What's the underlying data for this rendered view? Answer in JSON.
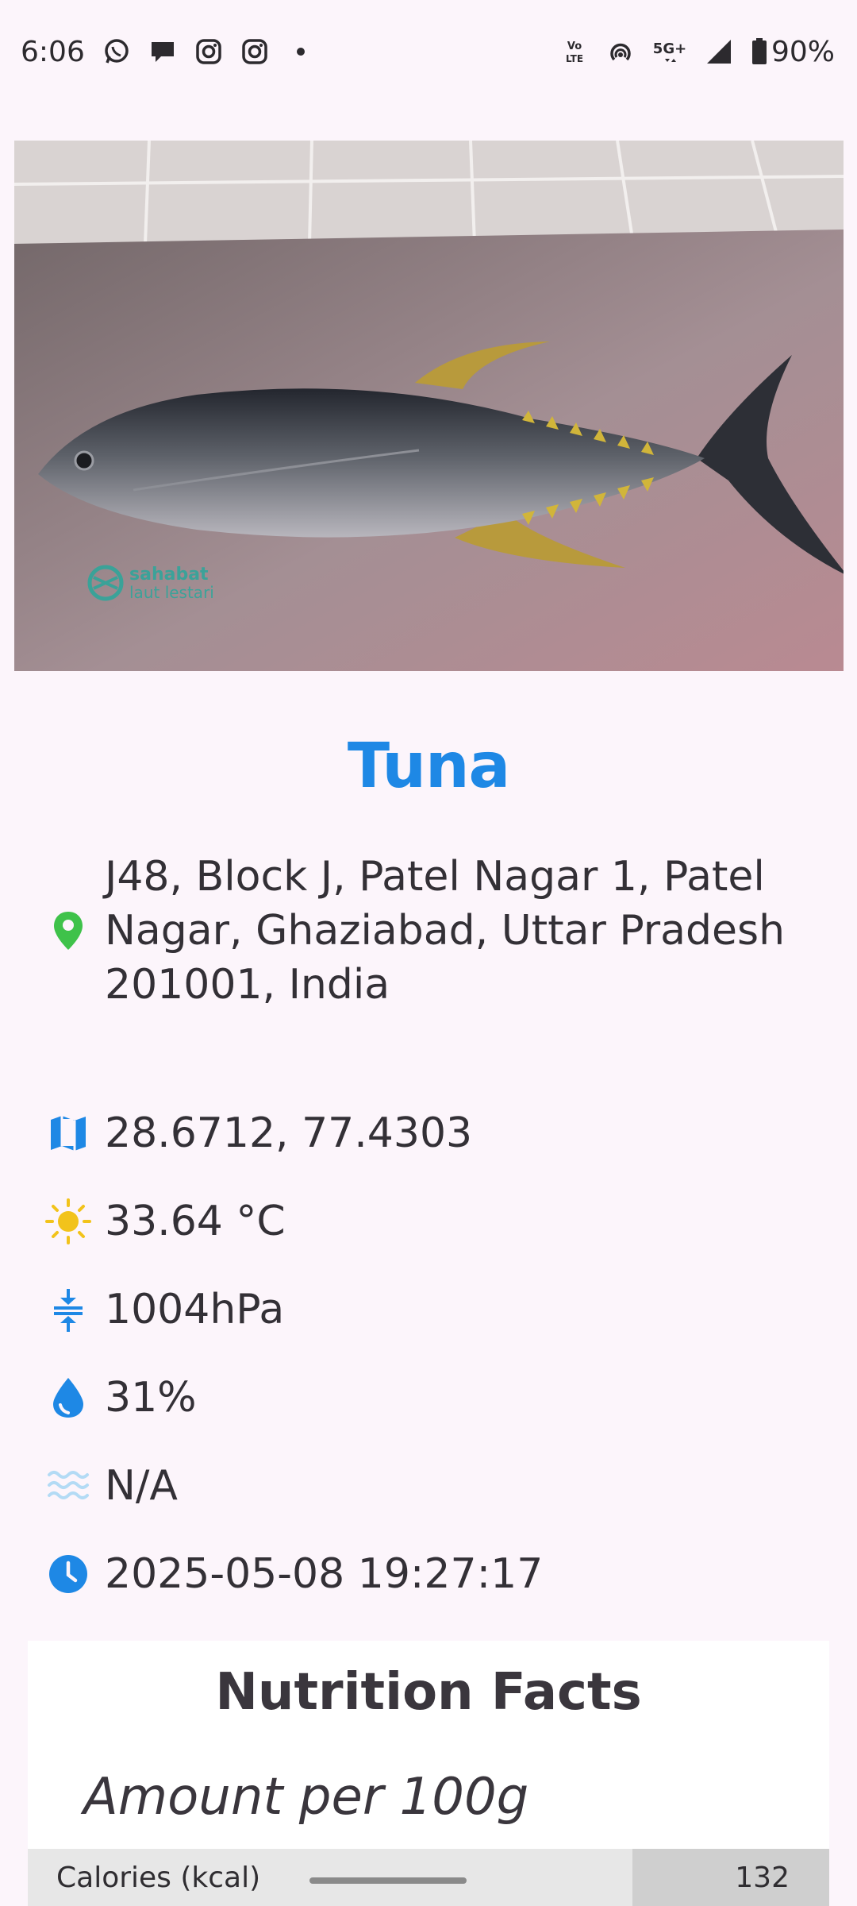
{
  "status_bar": {
    "time": "6:06",
    "battery": "90%",
    "network": "5G+",
    "left_icons": [
      "whatsapp-icon",
      "message-icon",
      "instagram-icon",
      "instagram-icon",
      "dot-icon"
    ],
    "right_icons": [
      "volte-icon",
      "hotspot-icon",
      "5g-icon",
      "signal-icon",
      "battery-icon"
    ]
  },
  "hero": {
    "image": "tuna-fish-photo",
    "watermark_line1": "sahabat",
    "watermark_line2": "laut lestari"
  },
  "title": "Tuna",
  "info": {
    "address": "J48, Block J, Patel Nagar 1, Patel Nagar, Ghaziabad, Uttar Pradesh 201001, India",
    "coordinates": "28.6712, 77.4303",
    "temperature": "33.64 °C",
    "pressure": "1004hPa",
    "humidity": "31%",
    "wave": "N/A",
    "datetime": "2025-05-08 19:27:17"
  },
  "colors": {
    "title": "#1e88e5",
    "location_icon": "#3fc24a",
    "info_icon": "#1e88e5",
    "sun_icon": "#f2c31b",
    "wave_icon": "#b3dbf5"
  },
  "nutrition": {
    "title": "Nutrition Facts",
    "amount": "Amount per 100g",
    "rows": [
      {
        "label": "Calories (kcal)",
        "value": "132",
        "bar_fraction": 0.66
      }
    ]
  }
}
